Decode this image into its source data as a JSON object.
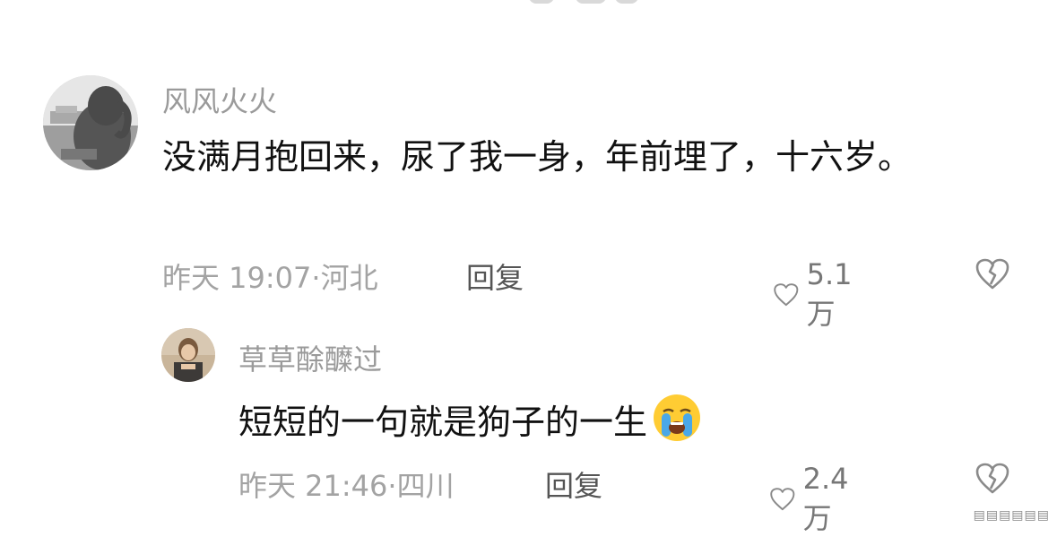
{
  "comments": [
    {
      "username": "风风火火",
      "text": "没满月抱回来，尿了我一身，年前埋了，十六岁。",
      "time": "昨天 19:07",
      "location": "河北",
      "reply_label": "回复",
      "likes": "5.1万",
      "avatar_icon": "elephant-avatar"
    },
    {
      "username": "草草酴醾过",
      "text": "短短的一句就是狗子的一生",
      "emoji": "loudly-crying-face",
      "time": "昨天 21:46",
      "location": "四川",
      "reply_label": "回复",
      "likes": "2.4万",
      "avatar_icon": "person-avatar"
    }
  ],
  "icons": {
    "like": "heart-outline-icon",
    "dislike": "broken-heart-icon"
  },
  "colors": {
    "username": "#9a9a9a",
    "text": "#111111",
    "meta": "#a3a3a3"
  }
}
